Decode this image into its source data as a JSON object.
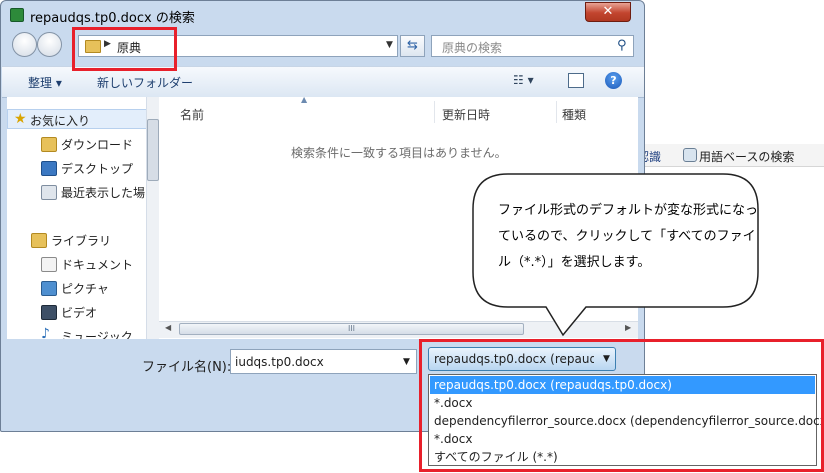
{
  "window": {
    "title": "repaudqs.tp0.docx の検索",
    "close_label": "✕"
  },
  "address": {
    "crumb": "原典"
  },
  "search": {
    "placeholder": "原典の検索"
  },
  "toolbar": {
    "organize": "整理 ▾",
    "new_folder": "新しいフォルダー",
    "view_icon": "☷ ▾",
    "help": "?"
  },
  "nav": {
    "items": [
      {
        "label": "お気に入り"
      },
      {
        "label": "ダウンロード"
      },
      {
        "label": "デスクトップ"
      },
      {
        "label": "最近表示した場"
      },
      {
        "label": "ライブラリ"
      },
      {
        "label": "ドキュメント"
      },
      {
        "label": "ピクチャ"
      },
      {
        "label": "ビデオ"
      },
      {
        "label": "ミュージック"
      }
    ]
  },
  "columns": {
    "name": "名前",
    "modified": "更新日時",
    "type": "種類"
  },
  "content": {
    "empty_message": "検索条件に一致する項目はありません。"
  },
  "scrollbar": {
    "grip": "III"
  },
  "filename": {
    "label": "ファイル名(N):",
    "value": "iudqs.tp0.docx"
  },
  "filetype": {
    "selected": "repaudqs.tp0.docx (repaudqs",
    "options": [
      "repaudqs.tp0.docx (repaudqs.tp0.docx)",
      "*.docx",
      "dependencyfilerror_source.docx (dependencyfilerror_source.docx)",
      "*.docx",
      "すべてのファイル (*.*)"
    ]
  },
  "background_app": {
    "tab1": "認識",
    "tab2": "用語ベースの検索"
  },
  "callout": {
    "text": "ファイル形式のデフォルトが変な形式になっているので、クリックして「すべてのファイル（*.*）」を選択します。"
  },
  "colors": {
    "highlight": "#e8202b",
    "selection": "#3399ff",
    "dialog_frame": "#c9daee"
  }
}
